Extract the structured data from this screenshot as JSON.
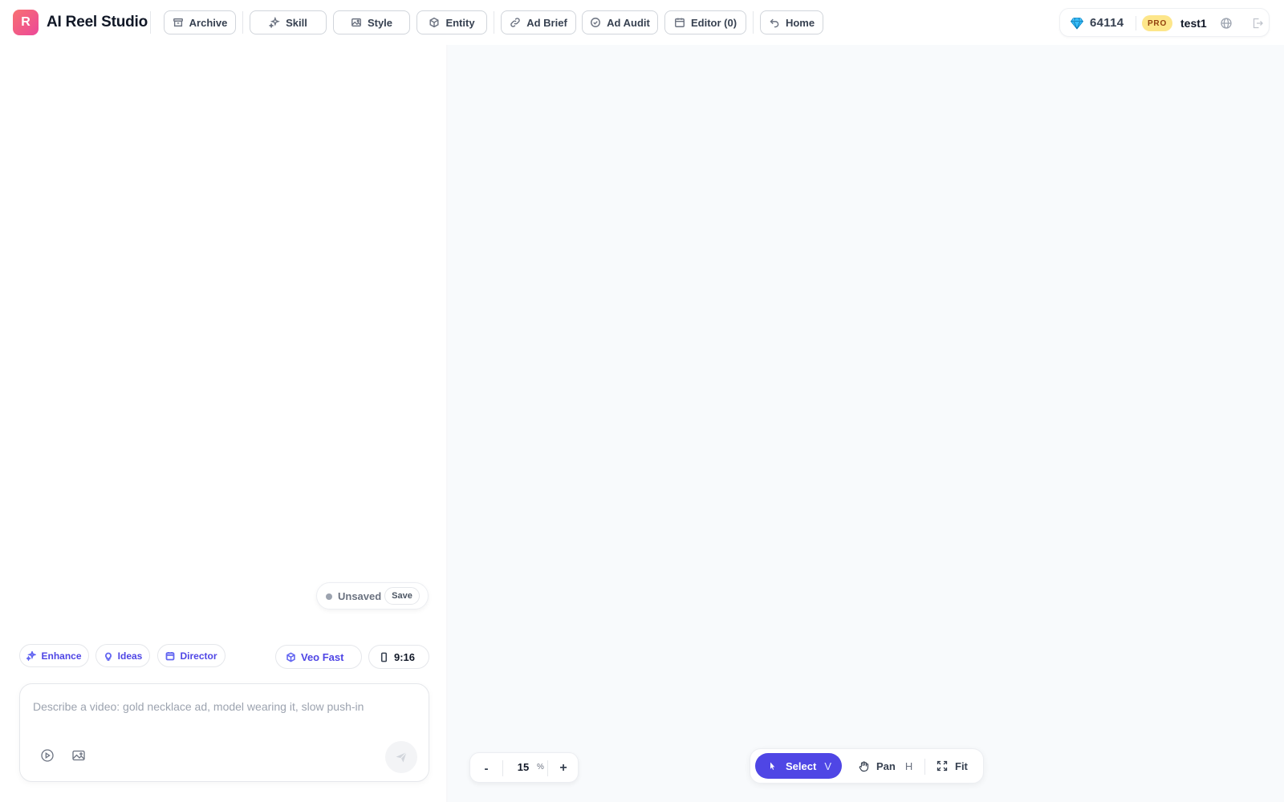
{
  "app": {
    "logo_letter": "R",
    "title": "AI Reel Studio"
  },
  "nav": {
    "archive": "Archive",
    "skill": "Skill",
    "style": "Style",
    "entity": "Entity",
    "ad_brief": "Ad Brief",
    "ad_audit": "Ad Audit",
    "editor": "Editor (0)",
    "home": "Home"
  },
  "user": {
    "credits": "64114",
    "plan_badge": "PRO",
    "username": "test1"
  },
  "save_state": {
    "status": "Unsaved",
    "save_label": "Save"
  },
  "prompt_tools": {
    "enhance": "Enhance",
    "ideas": "Ideas",
    "director": "Director"
  },
  "model": {
    "selected": "Veo Fast"
  },
  "aspect_ratio": {
    "selected": "9:16"
  },
  "prompt": {
    "placeholder": "Describe a video: gold necklace ad, model wearing it, slow push-in",
    "value": ""
  },
  "zoom": {
    "minus": "-",
    "value": "15",
    "unit": "%",
    "plus": "+"
  },
  "tools": {
    "select": {
      "label": "Select",
      "shortcut": "V"
    },
    "pan": {
      "label": "Pan",
      "shortcut": "H"
    },
    "fit": {
      "label": "Fit"
    }
  },
  "colors": {
    "accent": "#4f46e5",
    "pro_badge_bg": "#fde68a",
    "canvas_bg": "#f8fafc",
    "logo_gradient_start": "#f87171",
    "logo_gradient_end": "#ec4899"
  },
  "icons": {
    "archive": "archive-box-icon",
    "skill": "sparkles-icon",
    "style": "image-icon",
    "entity": "cube-icon",
    "ad_brief": "link-icon",
    "ad_audit": "check-circle-icon",
    "editor": "calendar-icon",
    "home": "undo-arrow-icon",
    "credits": "gem-icon",
    "language": "globe-icon",
    "logout": "logout-icon"
  }
}
